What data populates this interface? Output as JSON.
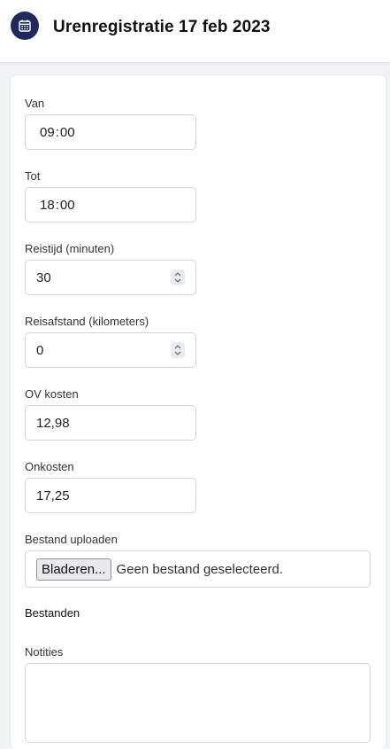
{
  "header": {
    "title": "Urenregistratie 17 feb 2023",
    "icon": "calendar-icon"
  },
  "form": {
    "van": {
      "label": "Van",
      "hours": "09",
      "minutes": "00"
    },
    "tot": {
      "label": "Tot",
      "hours": "18",
      "minutes": "00"
    },
    "reistijd": {
      "label": "Reistijd (minuten)",
      "value": "30"
    },
    "reisafstand": {
      "label": "Reisafstand (kilometers)",
      "value": "0"
    },
    "ov_kosten": {
      "label": "OV kosten",
      "value": "12,98"
    },
    "onkosten": {
      "label": "Onkosten",
      "value": "17,25"
    },
    "upload": {
      "label": "Bestand uploaden",
      "button": "Bladeren...",
      "status": "Geen bestand geselecteerd."
    },
    "bestanden": {
      "label": "Bestanden"
    },
    "notities": {
      "label": "Notities",
      "value": ""
    }
  },
  "colors": {
    "accent": "#1f2a5a",
    "border": "#ced4da",
    "background": "#f1f3f6"
  }
}
